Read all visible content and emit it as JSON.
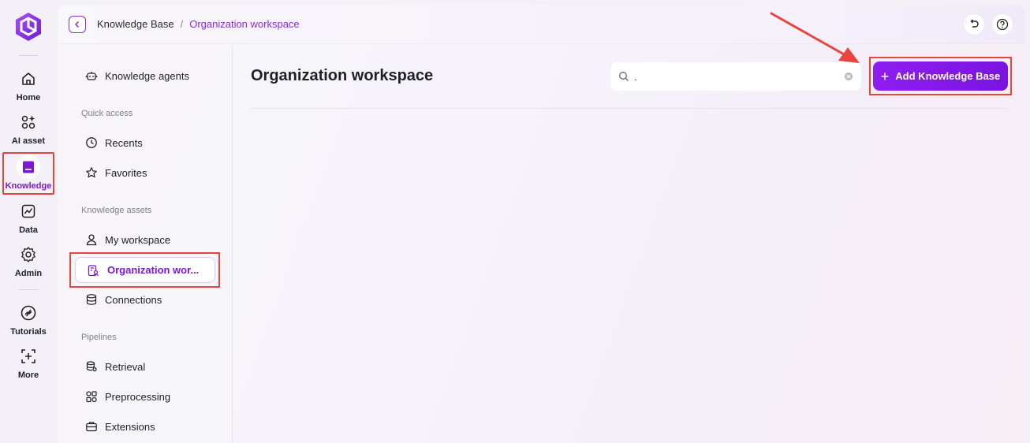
{
  "rail": {
    "items": [
      {
        "label": "Home",
        "icon": "home-icon"
      },
      {
        "label": "AI asset",
        "icon": "ai-asset-icon"
      },
      {
        "label": "Knowledge",
        "icon": "knowledge-icon"
      },
      {
        "label": "Data",
        "icon": "data-chart-icon"
      },
      {
        "label": "Admin",
        "icon": "gear-icon"
      },
      {
        "label": "Tutorials",
        "icon": "tutorials-icon"
      },
      {
        "label": "More",
        "icon": "plus-square-icon"
      }
    ],
    "active": "Knowledge"
  },
  "breadcrumb": {
    "root": "Knowledge Base",
    "separator": "/",
    "current": "Organization workspace"
  },
  "sidebar": {
    "agents_label": "Knowledge agents",
    "quick_access_heading": "Quick access",
    "recents_label": "Recents",
    "favorites_label": "Favorites",
    "assets_heading": "Knowledge assets",
    "my_workspace_label": "My workspace",
    "org_workspace_label": "Organization wor...",
    "connections_label": "Connections",
    "pipelines_heading": "Pipelines",
    "retrieval_label": "Retrieval",
    "preprocessing_label": "Preprocessing",
    "extensions_label": "Extensions"
  },
  "main": {
    "title": "Organization workspace",
    "search_value": ".",
    "add_button_label": "Add Knowledge Base"
  },
  "colors": {
    "accent": "#8a2be2",
    "highlight_frame": "#e8453c",
    "arrow": "#e8453c"
  }
}
